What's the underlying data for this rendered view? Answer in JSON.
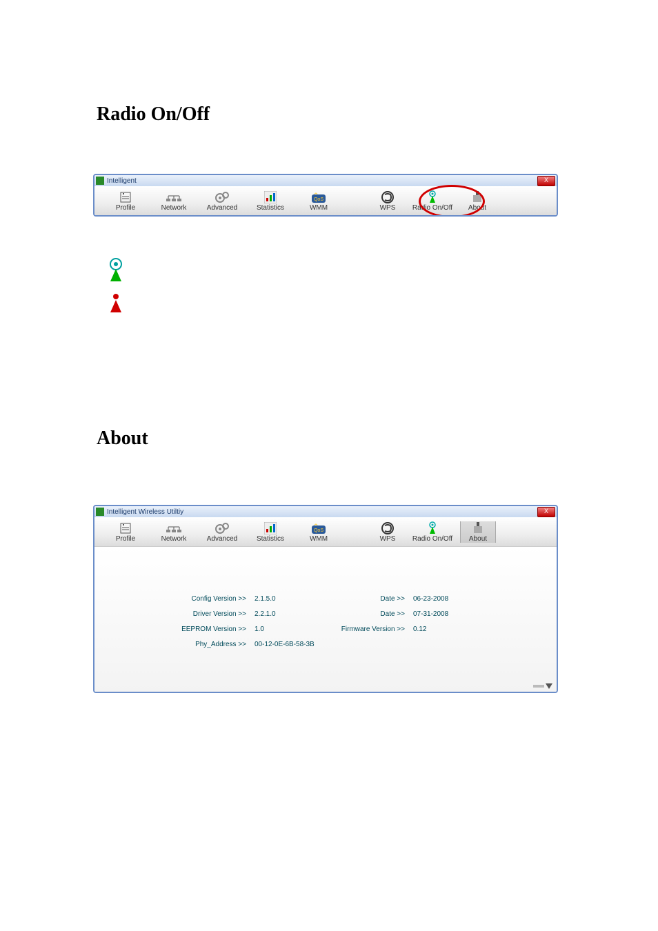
{
  "headings": {
    "radio": "Radio On/Off",
    "about": "About"
  },
  "window1": {
    "title": "Intelligent",
    "close": "X",
    "tabs": {
      "profile": "Profile",
      "network": "Network",
      "advanced": "Advanced",
      "statistics": "Statistics",
      "wmm": "WMM",
      "wps": "WPS",
      "radio": "Radio On/Off",
      "about": "About"
    }
  },
  "window2": {
    "title": "Intelligent Wireless Utiltiy",
    "close": "X",
    "tabs": {
      "profile": "Profile",
      "network": "Network",
      "advanced": "Advanced",
      "statistics": "Statistics",
      "wmm": "WMM",
      "wps": "WPS",
      "radio": "Radio On/Off",
      "about": "About"
    },
    "about": {
      "config_label": "Config Version >>",
      "config_value": "2.1.5.0",
      "config_date_label": "Date >>",
      "config_date_value": "06-23-2008",
      "driver_label": "Driver Version >>",
      "driver_value": "2.2.1.0",
      "driver_date_label": "Date >>",
      "driver_date_value": "07-31-2008",
      "eeprom_label": "EEPROM Version >>",
      "eeprom_value": "1.0",
      "firmware_label": "Firmware Version >>",
      "firmware_value": "0.12",
      "phy_label": "Phy_Address >>",
      "phy_value": "00-12-0E-6B-58-3B"
    }
  }
}
